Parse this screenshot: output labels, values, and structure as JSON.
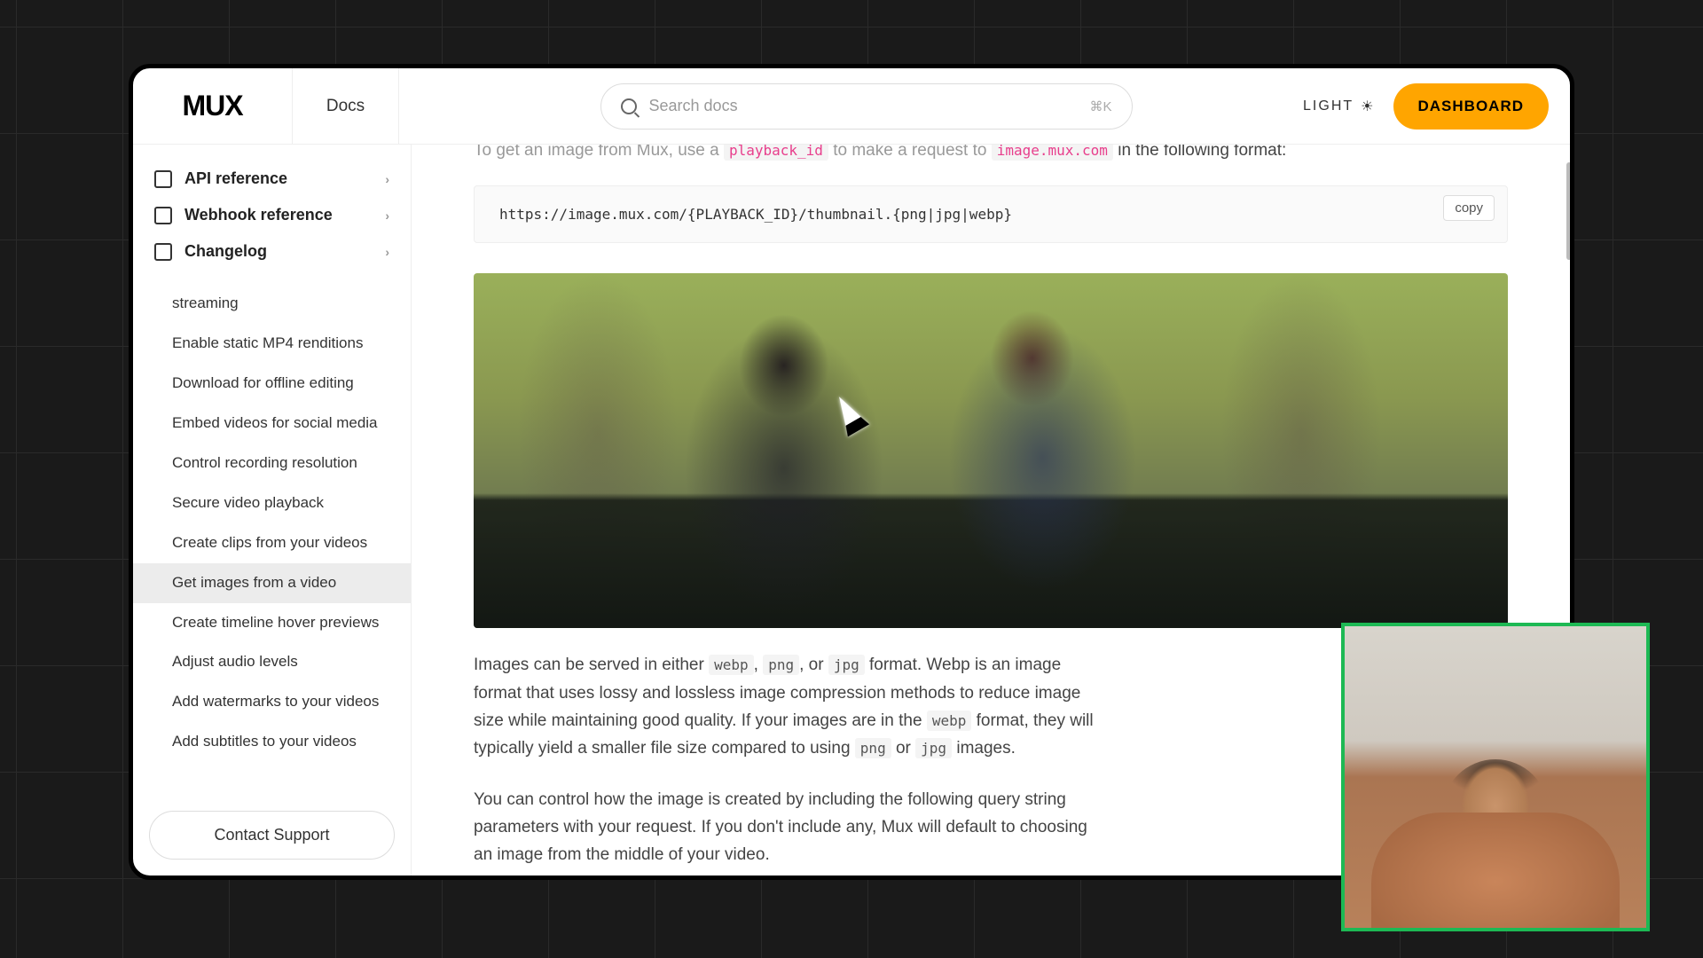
{
  "header": {
    "logo": "MUX",
    "docs_label": "Docs",
    "search_placeholder": "Search docs",
    "keyboard_hint": "⌘K",
    "theme_label": "LIGHT",
    "dashboard_label": "DASHBOARD"
  },
  "sidebar": {
    "top": [
      {
        "label": "API reference",
        "bold": true
      },
      {
        "label": "Webhook reference",
        "bold": true
      },
      {
        "label": "Changelog",
        "bold": true
      }
    ],
    "items": [
      "streaming",
      "Enable static MP4 renditions",
      "Download for offline editing",
      "Embed videos for social media",
      "Control recording resolution",
      "Secure video playback",
      "Create clips from your videos",
      "Get images from a video",
      "Create timeline hover previews",
      "Adjust audio levels",
      "Add watermarks to your videos",
      "Add subtitles to your videos"
    ],
    "active_index": 7,
    "contact_support": "Contact Support"
  },
  "content": {
    "intro_pre": "To get an image from Mux, use a ",
    "intro_code1": "playback_id",
    "intro_mid": " to make a request to ",
    "intro_code2": "image.mux.com",
    "intro_post": " in the following format:",
    "code_block": "https://image.mux.com/{PLAYBACK_ID}/thumbnail.{png|jpg|webp}",
    "copy_label": "copy",
    "para1_a": "Images can be served in either ",
    "para1_webp": "webp",
    "para1_b": ", ",
    "para1_png": "png",
    "para1_c": ", or ",
    "para1_jpg": "jpg",
    "para1_d": " format. Webp is an image format that uses lossy and lossless image compression methods to reduce image size while maintaining good quality. If your images are in the ",
    "para1_webp2": "webp",
    "para1_e": " format, they will typically yield a smaller file size compared to using ",
    "para1_png2": "png",
    "para1_f": " or ",
    "para1_jpg2": "jpg",
    "para1_g": " images.",
    "para2": "You can control how the image is created by including the following query string parameters with your request. If you don't include any, Mux will default to choosing an image from the middle of your video."
  }
}
